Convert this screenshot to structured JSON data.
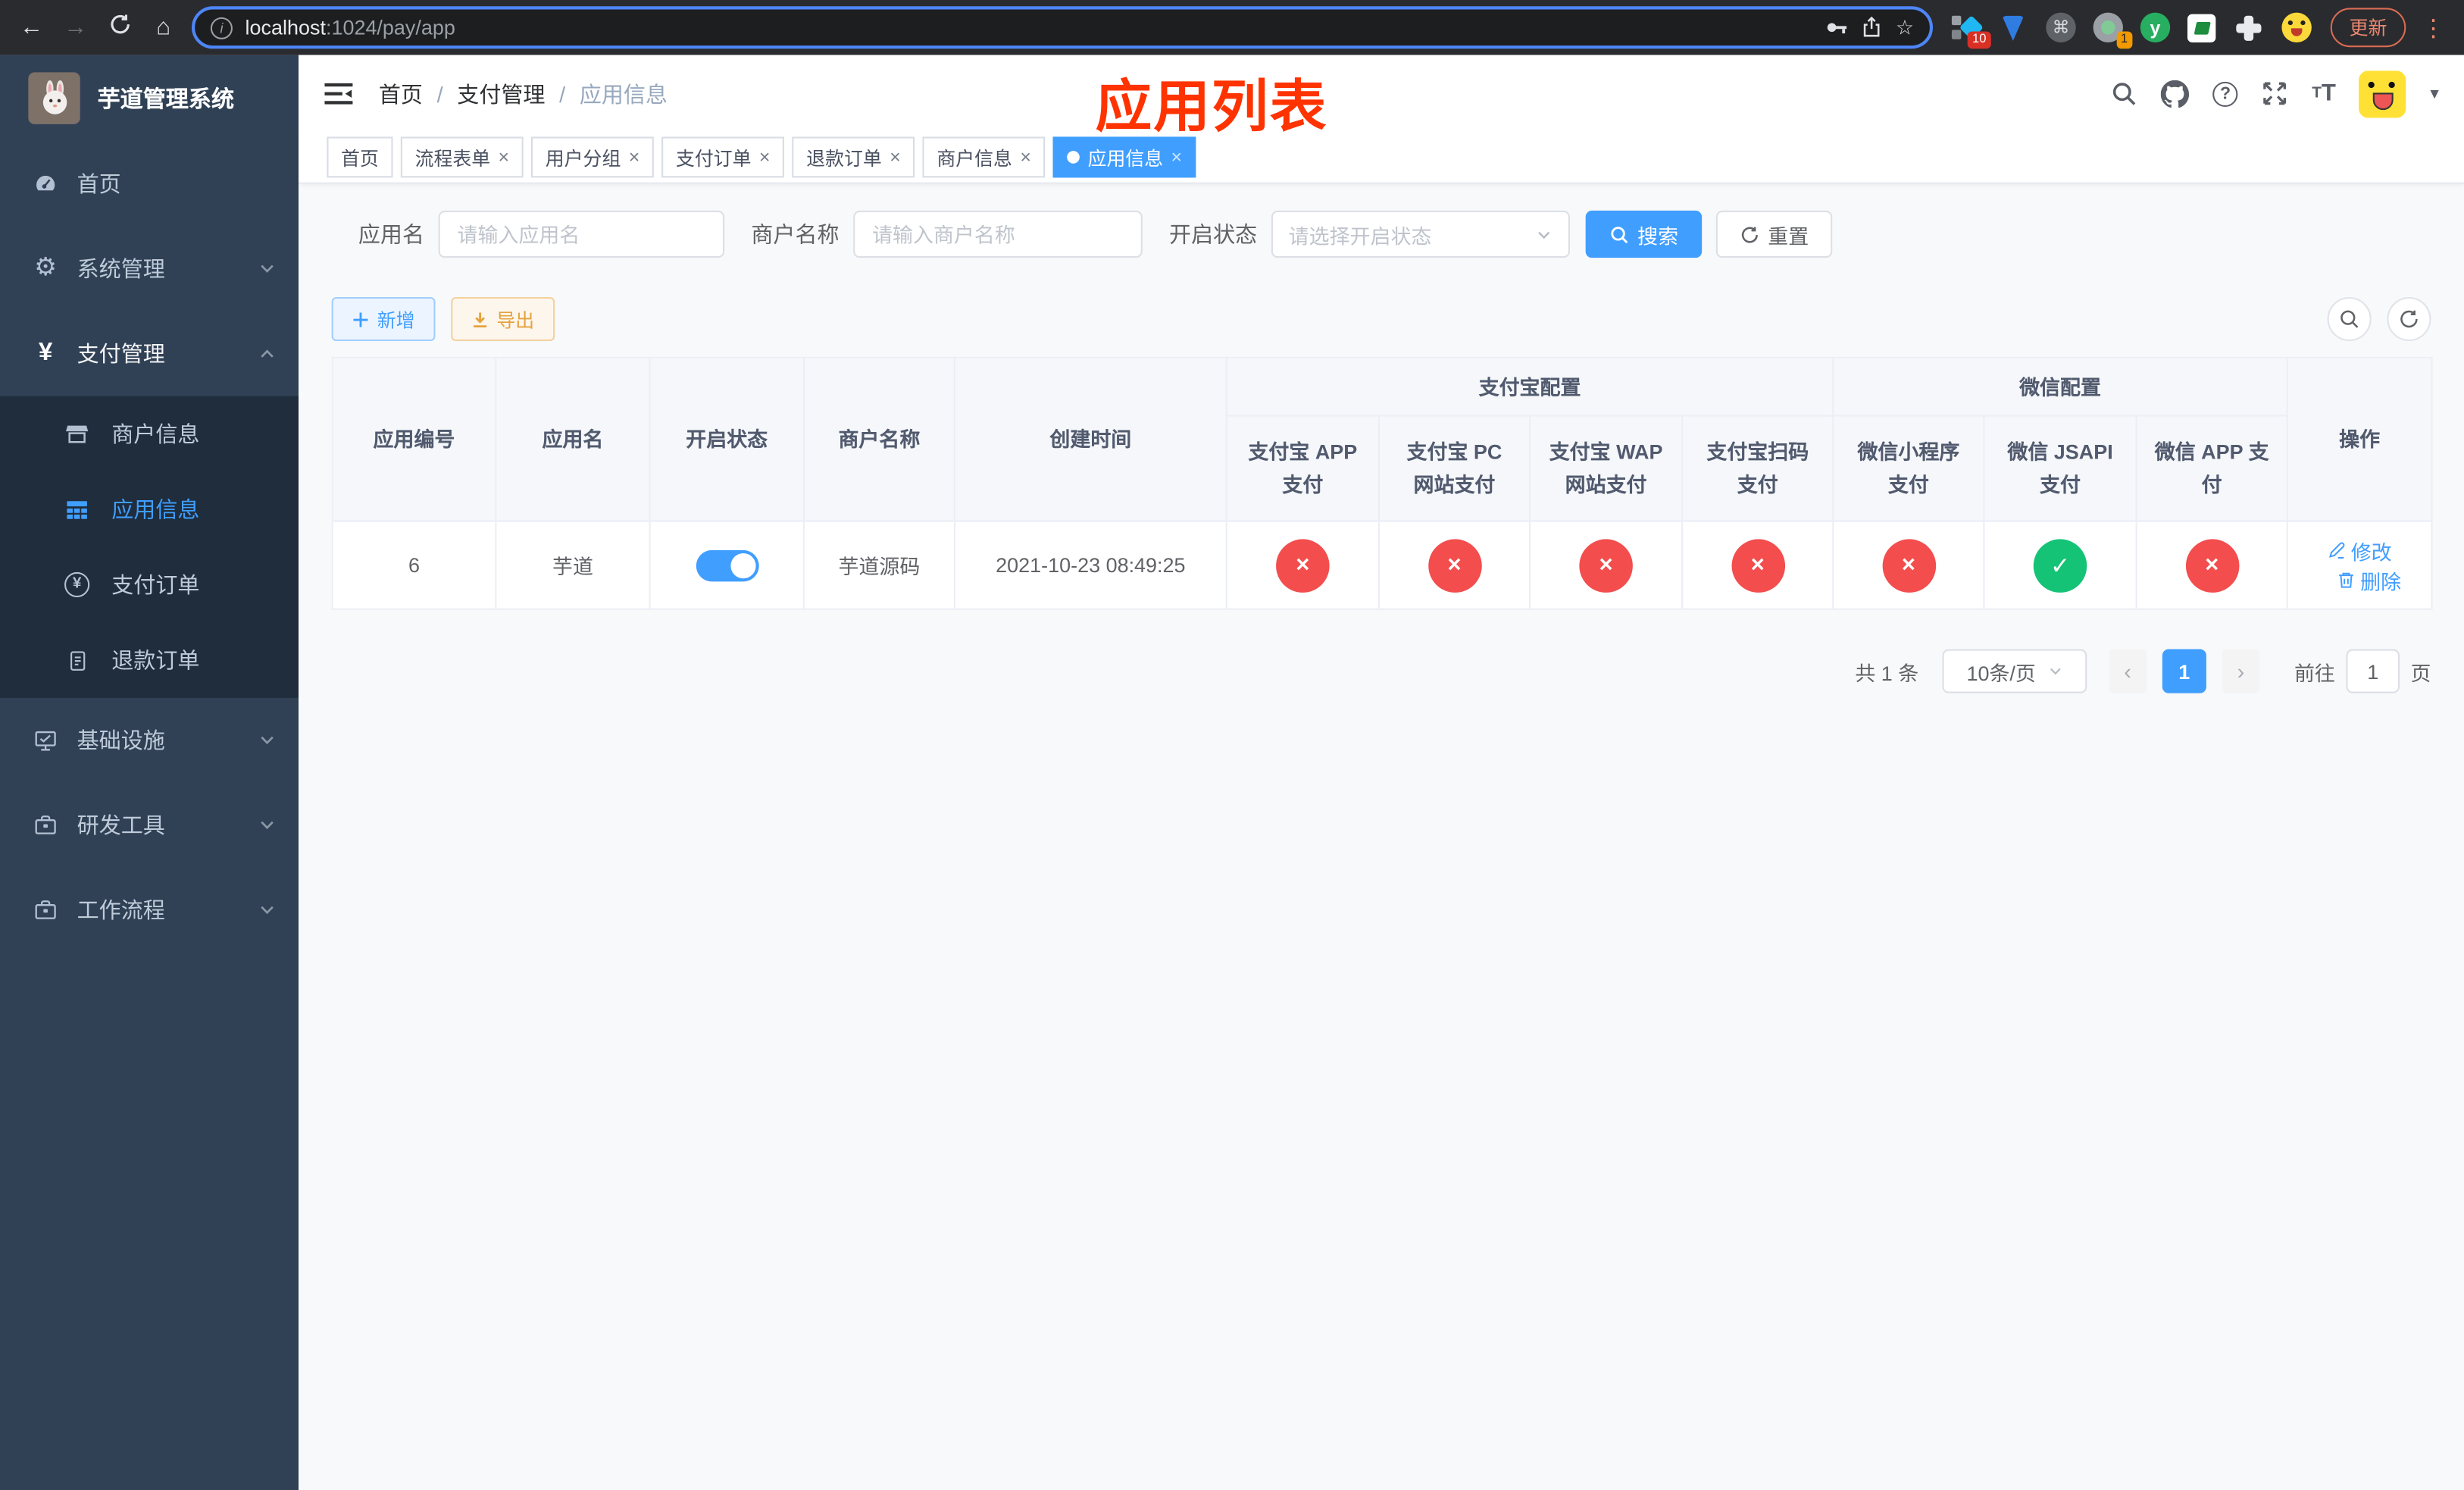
{
  "browser": {
    "url_host": "localhost",
    "url_rest": ":1024/pay/app",
    "update_label": "更新",
    "extension_badge_a": "10",
    "extension_badge_b": "1",
    "extension_y_letter": "y"
  },
  "sidebar": {
    "title": "芋道管理系统",
    "items": [
      {
        "id": "home",
        "label": "首页",
        "icon": "gauge-icon",
        "type": "top"
      },
      {
        "id": "system-management",
        "label": "系统管理",
        "icon": "gear-icon",
        "type": "top",
        "chevron": "down"
      },
      {
        "id": "payment-management",
        "label": "支付管理",
        "icon": "yen-icon",
        "type": "top",
        "chevron": "up",
        "active": true
      },
      {
        "id": "merchant-info",
        "label": "商户信息",
        "icon": "store-icon",
        "type": "sub"
      },
      {
        "id": "app-info",
        "label": "应用信息",
        "icon": "grid-icon",
        "type": "sub",
        "selected": true
      },
      {
        "id": "payment-order",
        "label": "支付订单",
        "icon": "yen-circle-icon",
        "type": "sub"
      },
      {
        "id": "refund-order",
        "label": "退款订单",
        "icon": "document-icon",
        "type": "sub"
      },
      {
        "id": "infrastructure",
        "label": "基础设施",
        "icon": "monitor-icon",
        "type": "top",
        "chevron": "down"
      },
      {
        "id": "dev-tools",
        "label": "研发工具",
        "icon": "toolbox-icon",
        "type": "top",
        "chevron": "down"
      },
      {
        "id": "workflow",
        "label": "工作流程",
        "icon": "toolbox-icon",
        "type": "top",
        "chevron": "down"
      }
    ]
  },
  "header": {
    "breadcrumb": [
      "首页",
      "支付管理",
      "应用信息"
    ],
    "annotation": "应用列表"
  },
  "tabs": [
    {
      "id": "home",
      "label": "首页",
      "closable": false
    },
    {
      "id": "process-form",
      "label": "流程表单",
      "closable": true
    },
    {
      "id": "user-group",
      "label": "用户分组",
      "closable": true
    },
    {
      "id": "payment-order",
      "label": "支付订单",
      "closable": true
    },
    {
      "id": "refund-order",
      "label": "退款订单",
      "closable": true
    },
    {
      "id": "merchant-info",
      "label": "商户信息",
      "closable": true
    },
    {
      "id": "app-info",
      "label": "应用信息",
      "closable": true,
      "active": true
    }
  ],
  "filters": {
    "app_name_label": "应用名",
    "app_name_placeholder": "请输入应用名",
    "merchant_label": "商户名称",
    "merchant_placeholder": "请输入商户名称",
    "status_label": "开启状态",
    "status_placeholder": "请选择开启状态",
    "search_label": "搜索",
    "reset_label": "重置"
  },
  "toolbar": {
    "add_label": "新增",
    "export_label": "导出"
  },
  "table": {
    "simple_headers": [
      "应用编号",
      "应用名",
      "开启状态",
      "商户名称",
      "创建时间"
    ],
    "group_headers": [
      {
        "label": "支付宝配置",
        "children": [
          "支付宝 APP 支付",
          "支付宝 PC 网站支付",
          "支付宝 WAP 网站支付",
          "支付宝扫码支付"
        ]
      },
      {
        "label": "微信配置",
        "children": [
          "微信小程序支付",
          "微信 JSAPI 支付",
          "微信 APP 支付"
        ]
      }
    ],
    "action_header": "操作",
    "row": {
      "id": "6",
      "name": "芋道",
      "enabled": true,
      "merchant": "芋道源码",
      "created": "2021-10-23 08:49:25",
      "statuses": [
        "no",
        "no",
        "no",
        "no",
        "no",
        "yes",
        "no"
      ],
      "edit_label": "修改",
      "delete_label": "删除"
    }
  },
  "pagination": {
    "total": "共 1 条",
    "page_size": "10条/页",
    "page": "1",
    "goto_prefix": "前往",
    "goto_value": "1",
    "goto_suffix": "页"
  },
  "colors": {
    "accent": "#409eff",
    "success": "#15c377",
    "danger": "#f34d4d",
    "warning": "#e6a23c",
    "annotation_red": "#ff3300",
    "sidebar_bg": "#304156",
    "submenu_bg": "#1f2d3d",
    "chrome_focus_ring": "#4e86f7",
    "update_pill": "#ec8871"
  }
}
